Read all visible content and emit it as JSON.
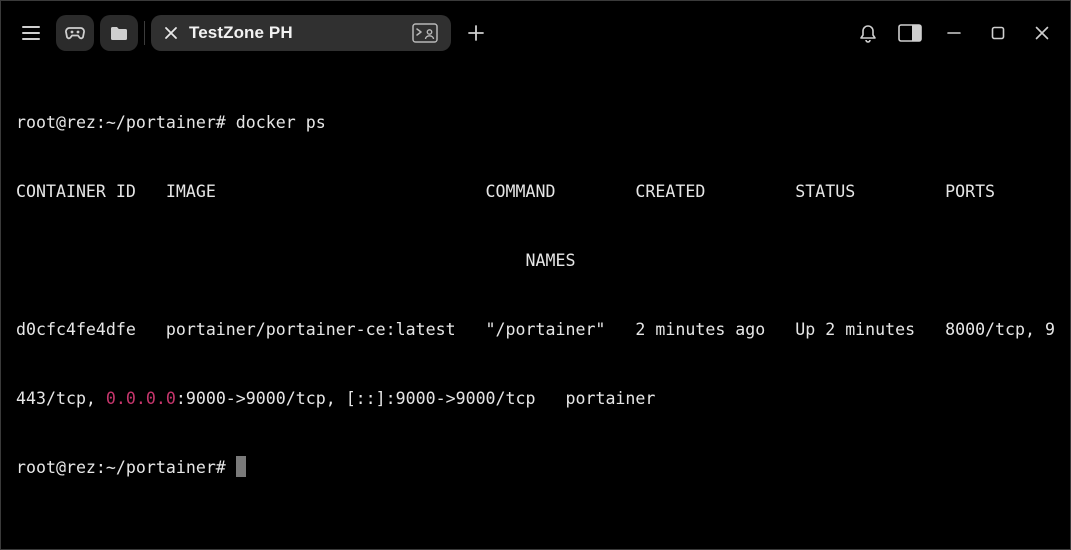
{
  "tab": {
    "title": "TestZone PH"
  },
  "icons": {
    "menu": "hamburger-menu-icon",
    "game": "gamepad-icon",
    "folder": "folder-icon",
    "tab_close": "close-icon",
    "tab_terminal": "terminal-icon",
    "new_tab": "plus-icon",
    "notifications": "bell-icon",
    "side_panel": "side-panel-icon",
    "minimize": "minimize-icon",
    "maximize": "maximize-icon",
    "close_window": "close-icon"
  },
  "colors": {
    "background": "#000000",
    "text": "#e6e6e6",
    "highlight_ip": "#c5366c",
    "tab_background": "#303030"
  },
  "terminal": {
    "prompt": "root@rez:~/portainer# ",
    "command": "docker ps",
    "header_line": "CONTAINER ID   IMAGE                           COMMAND        CREATED         STATUS         PORTS",
    "header_wrap": "                                                   NAMES",
    "row_line": "d0cfc4fe4dfe   portainer/portainer-ce:latest   \"/portainer\"   2 minutes ago   Up 2 minutes   8000/tcp, 9",
    "row_wrap_before_ip": "443/tcp, ",
    "row_wrap_ip": "0.0.0.0",
    "row_wrap_after_ip": ":9000->9000/tcp, [::]:9000->9000/tcp   portainer",
    "final_prompt": "root@rez:~/portainer# "
  }
}
